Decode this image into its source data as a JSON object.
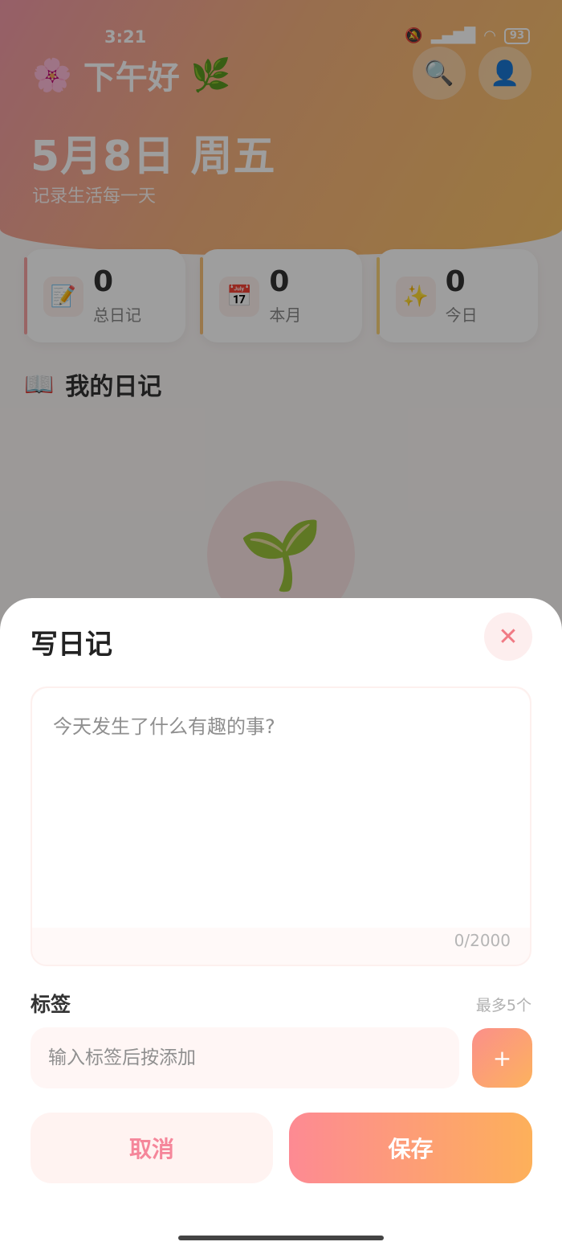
{
  "status_bar": {
    "time": "3:21",
    "battery": "93",
    "icons": [
      "mute-icon",
      "hd-signal-icon",
      "signal-icon",
      "wifi-icon",
      "battery-icon"
    ]
  },
  "header": {
    "flower_icon": "🌸",
    "greeting": "下午好",
    "leaf_icon": "🌿",
    "search_icon": "🔍",
    "profile_icon": "👤",
    "date": "5月8日 周五",
    "subtitle": "记录生活每一天"
  },
  "stats": [
    {
      "icon": "📝",
      "value": "0",
      "label": "总日记",
      "accent": "#f7a3a3"
    },
    {
      "icon": "📅",
      "value": "0",
      "label": "本月",
      "accent": "#f9c27a"
    },
    {
      "icon": "✨",
      "value": "0",
      "label": "今日",
      "accent": "#f9d27a"
    }
  ],
  "diary_section": {
    "icon": "📖",
    "title": "我的日记",
    "empty_icon": "🌱"
  },
  "sheet": {
    "title": "写日记",
    "close_icon": "✕",
    "content_placeholder": "今天发生了什么有趣的事?",
    "content_value": "",
    "counter": "0/2000",
    "tag_label": "标签",
    "tag_hint": "最多5个",
    "tag_placeholder": "输入标签后按添加",
    "tag_value": "",
    "add_label": "+",
    "cancel_label": "取消",
    "save_label": "保存"
  },
  "colors": {
    "accent_pink": "#f5869a",
    "accent_orange": "#fdb05a"
  }
}
